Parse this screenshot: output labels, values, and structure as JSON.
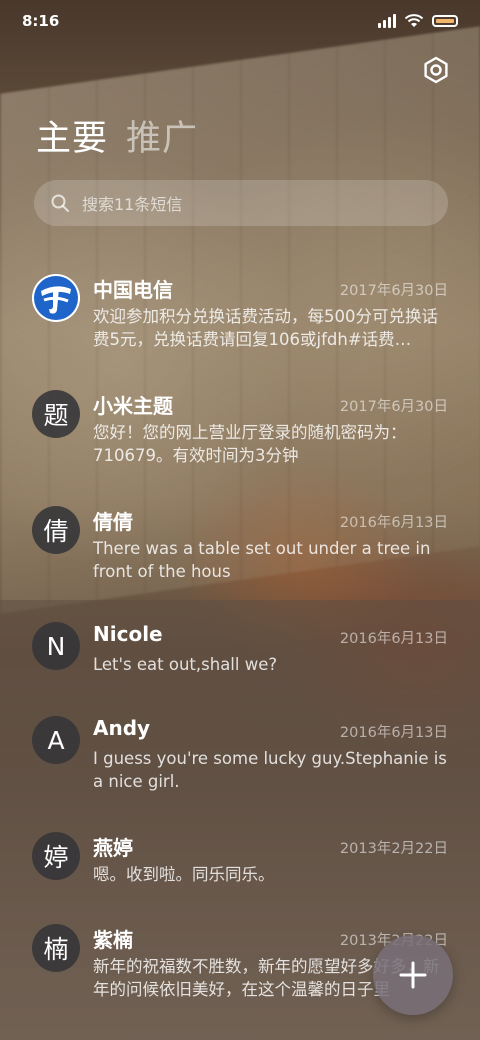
{
  "status_bar": {
    "time": "8:16"
  },
  "header": {
    "tabs": [
      {
        "label": "主要",
        "active": true
      },
      {
        "label": "推广",
        "active": false
      }
    ]
  },
  "search": {
    "placeholder": "搜索11条短信"
  },
  "messages": [
    {
      "avatar": "",
      "avatar_type": "china-telecom-logo",
      "sender": "中国电信",
      "date": "2017年6月30日",
      "preview": "欢迎参加积分兑换话费活动，每500分可兑换话费5元，兑换话费请回复106或jfdh#话费…"
    },
    {
      "avatar": "题",
      "sender": "小米主题",
      "date": "2017年6月30日",
      "preview": "您好！您的网上营业厅登录的随机密码为：710679。有效时间为3分钟"
    },
    {
      "avatar": "倩",
      "sender": "倩倩",
      "date": "2016年6月13日",
      "preview": "There was a table set out under a tree in front of the hous"
    },
    {
      "avatar": "N",
      "sender": "Nicole",
      "date": "2016年6月13日",
      "preview": "Let's eat out,shall we?"
    },
    {
      "avatar": "A",
      "sender": "Andy",
      "date": "2016年6月13日",
      "preview": "I guess you're some lucky guy.Stephanie is a nice girl."
    },
    {
      "avatar": "婷",
      "sender": "燕婷",
      "date": "2013年2月22日",
      "preview": "嗯。收到啦。同乐同乐。"
    },
    {
      "avatar": "楠",
      "sender": "紫楠",
      "date": "2013年2月22日",
      "preview": "新年的祝福数不胜数，新年的愿望好多好多，新年的问候依旧美好，在这个温馨的日子里"
    }
  ],
  "compose": {
    "icon": "plus-icon"
  },
  "colors": {
    "battery": "#f3b56b",
    "avatar_bg": "#343438",
    "telecom_blue": "#1f64c9"
  }
}
